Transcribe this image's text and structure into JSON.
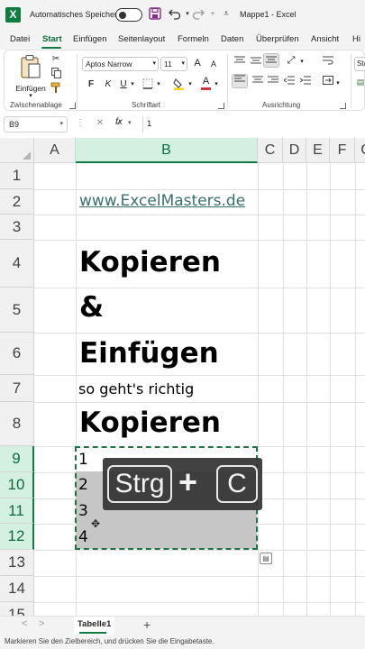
{
  "titlebar": {
    "logo_letter": "X",
    "autosave_label": "Automatisches Speichern",
    "save_icon": "save-icon",
    "undo_icon": "undo-icon",
    "redo_icon": "redo-icon",
    "customize_icon": "customize-icon",
    "title": "Mappe1 - Excel"
  },
  "menu": {
    "tabs": [
      "Datei",
      "Start",
      "Einfügen",
      "Seitenlayout",
      "Formeln",
      "Daten",
      "Überprüfen",
      "Ansicht",
      "Hi"
    ],
    "active": "Start"
  },
  "ribbon": {
    "clipboard": {
      "paste_label": "Einfügen",
      "group_label": "Zwischenablage"
    },
    "font": {
      "font_name": "Aptos Narrow",
      "font_size": "11",
      "grow": "A",
      "shrink": "A",
      "bold": "F",
      "italic": "K",
      "underline": "U",
      "group_label": "Schriftart"
    },
    "alignment": {
      "group_label": "Ausrichtung"
    },
    "number": {
      "format_label": "Sta"
    },
    "colors": {
      "accent": "#107c41",
      "font_color": "#d13438",
      "highlight": "#ffd400"
    }
  },
  "formula_bar": {
    "name_box": "B9",
    "icons": "⋮  ✕  ✓",
    "fx": "fx",
    "value": "1"
  },
  "grid": {
    "columns": [
      "A",
      "B",
      "C",
      "D",
      "E",
      "F",
      "G"
    ],
    "selected_column": "B",
    "rows": [
      "1",
      "2",
      "3",
      "4",
      "5",
      "6",
      "7",
      "8",
      "9",
      "10",
      "11",
      "12",
      "13",
      "14",
      "15"
    ],
    "selected_rows": [
      "9",
      "10",
      "11",
      "12"
    ],
    "cells": {
      "B2": "www.ExcelMasters.de",
      "B4": "Kopieren",
      "B5": "&",
      "B6": "Einfügen",
      "B7": "so geht's richtig",
      "B8": "Kopieren",
      "B9": "1",
      "B10": "2",
      "B11": "3",
      "B12": "4"
    }
  },
  "key_overlay": {
    "key1": "Strg",
    "plus": "+",
    "key2": "C"
  },
  "sheets": {
    "tabs": [
      "Tabelle1"
    ],
    "add": "+",
    "prev": "<",
    "next": ">"
  },
  "status": {
    "message": "Markieren Sie den Zielbereich, und drücken Sie die Eingabetaste."
  }
}
